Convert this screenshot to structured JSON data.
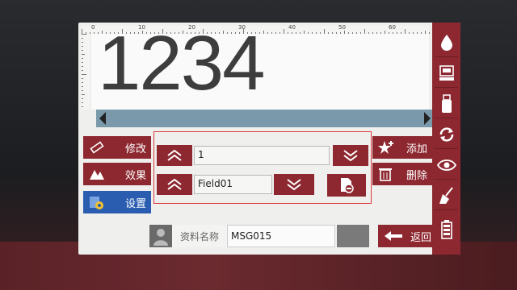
{
  "display": {
    "text": "1234"
  },
  "ruler": {
    "marks": [
      "0",
      "10",
      "20",
      "30",
      "40",
      "50",
      "60"
    ]
  },
  "left_buttons": [
    {
      "label": "修改",
      "icon": "pencil-icon"
    },
    {
      "label": "效果",
      "icon": "effect-icon"
    },
    {
      "label": "设置",
      "icon": "settings-icon",
      "selected": true
    }
  ],
  "editor": {
    "content_value": "1",
    "field_value": "Field01"
  },
  "right_buttons": [
    {
      "label": "添加",
      "icon": "add-star-icon"
    },
    {
      "label": "删除",
      "icon": "trash-icon"
    }
  ],
  "bottom": {
    "label": "资料名称",
    "value": "MSG015",
    "back_label": "返回"
  },
  "sidebar_icons": [
    "ink-drop-icon",
    "printer-icon",
    "usb-icon",
    "refresh-icon",
    "eye-icon",
    "broom-icon",
    "battery-icon"
  ],
  "colors": {
    "accent": "#8d2830",
    "selected": "#2a5db0",
    "frame": "#d83a3a"
  }
}
